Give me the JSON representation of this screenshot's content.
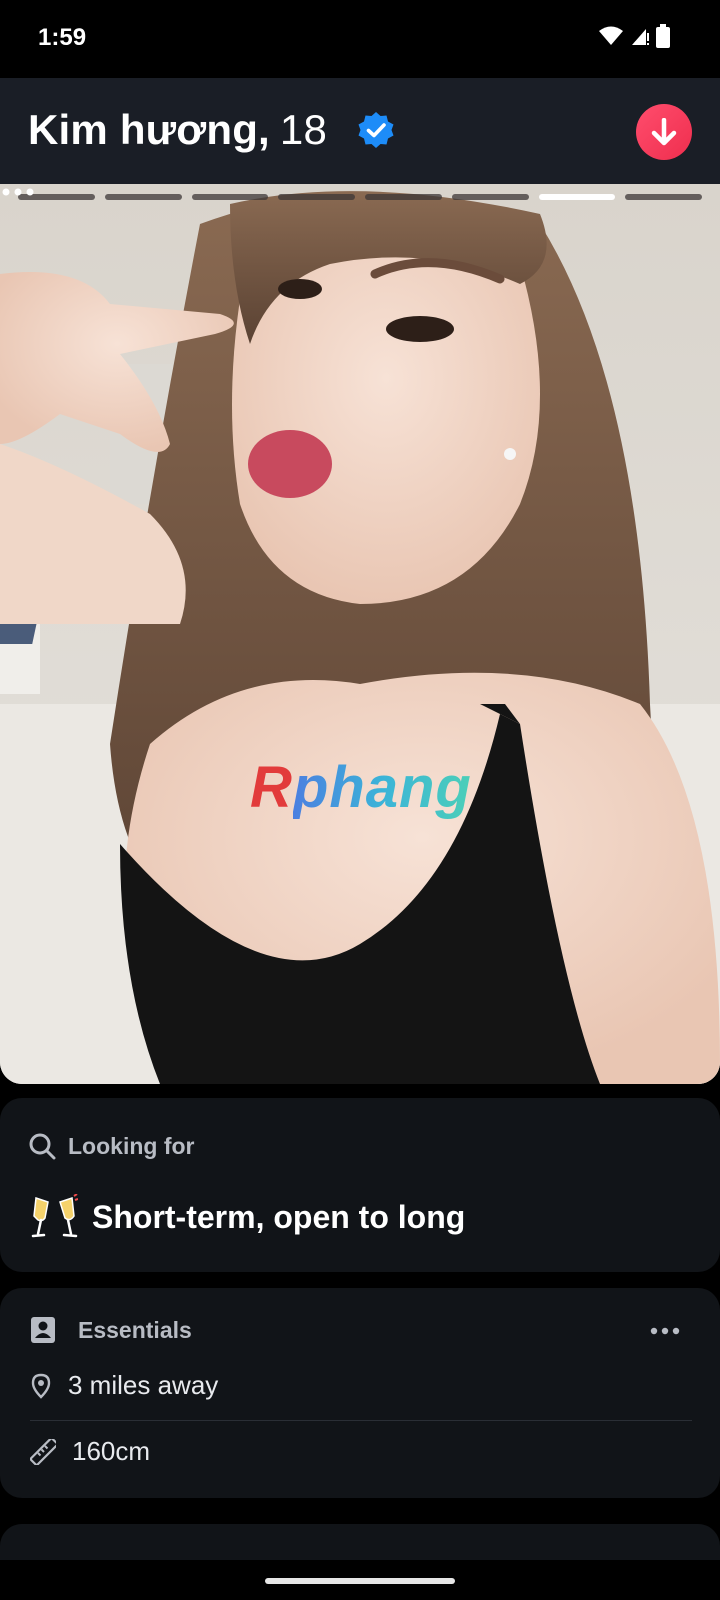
{
  "status_bar": {
    "time": "1:59",
    "icons": [
      "wifi-icon",
      "signal-icon",
      "battery-icon"
    ]
  },
  "profile": {
    "name": "Kim hương,",
    "age": "18",
    "verified": true,
    "photo_count": 8,
    "current_photo": 7
  },
  "photo": {
    "watermark_prefix": "R",
    "watermark_rest": "phang"
  },
  "looking_for": {
    "title": "Looking for",
    "emoji": "🥂",
    "value": "Short-term, open to long"
  },
  "essentials": {
    "title": "Essentials",
    "items": [
      {
        "icon": "location-pin-icon",
        "text": "3 miles away"
      },
      {
        "icon": "ruler-icon",
        "text": "160cm"
      }
    ]
  },
  "colors": {
    "accent": "#ef2e4e",
    "verified": "#1d8cf8",
    "card_bg": "#111418",
    "header_bg": "#1a1e26"
  }
}
